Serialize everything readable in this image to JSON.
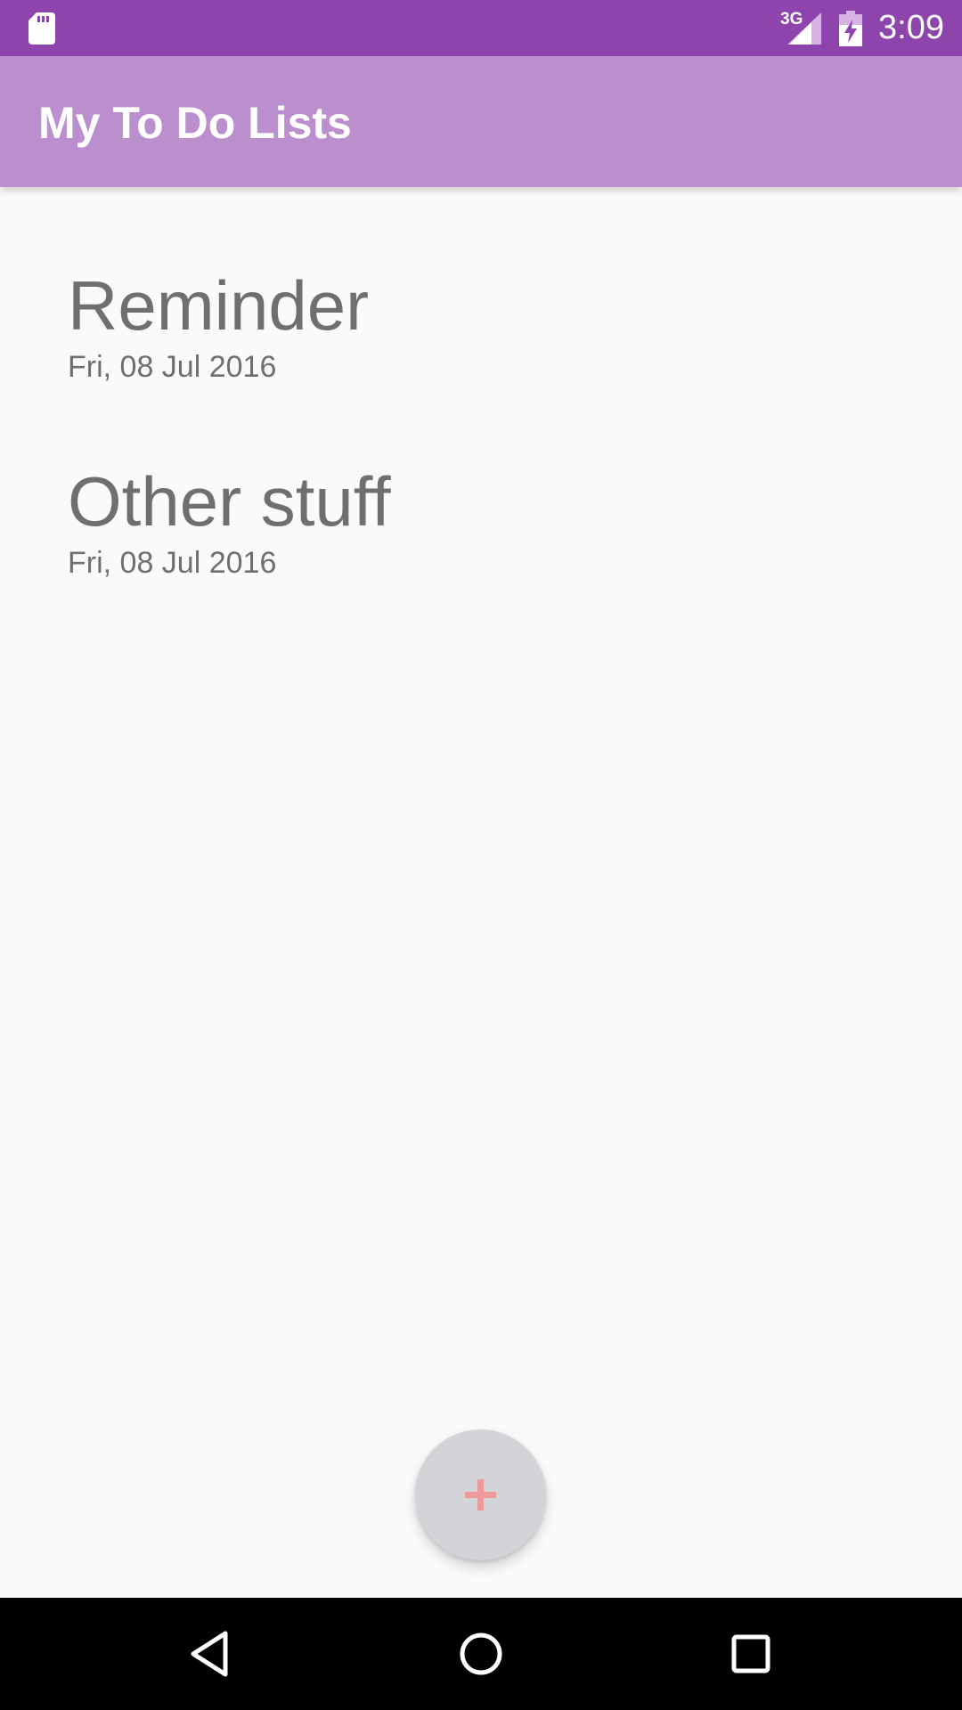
{
  "status_bar": {
    "network": "3G",
    "time": "3:09",
    "icons": [
      "sd-card-icon",
      "signal-icon",
      "battery-charging-icon"
    ]
  },
  "app_bar": {
    "title": "My To Do Lists"
  },
  "lists": [
    {
      "title": "Reminder",
      "date": "Fri, 08 Jul 2016"
    },
    {
      "title": "Other stuff",
      "date": "Fri, 08 Jul 2016"
    }
  ],
  "fab": {
    "icon": "plus-icon",
    "icon_color": "#ef9a9a"
  },
  "nav_bar": {
    "icons": [
      "back-icon",
      "home-icon",
      "recents-icon"
    ]
  },
  "colors": {
    "status_bar": "#8e44ad",
    "app_bar": "#bb8fce",
    "background": "#fafafa",
    "text": "#6f6f6f",
    "fab": "#d2d4d8"
  }
}
